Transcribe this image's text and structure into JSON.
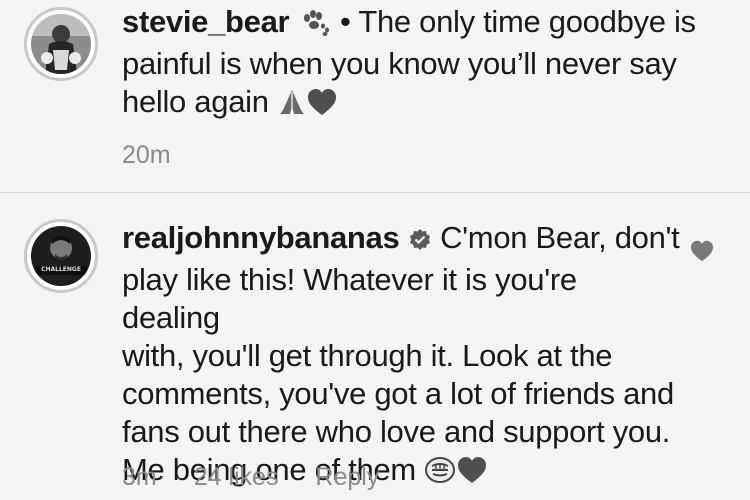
{
  "comments": [
    {
      "username": "stevie_bear",
      "separator": "•",
      "text_line1": "The only time goodbye is",
      "text_line2": "painful is when you know you’ll never say",
      "text_line3": "hello again",
      "time": "20m"
    },
    {
      "username": "realjohnnybananas",
      "text_line1": "C'mon Bear, don't",
      "text_line2": "play like this! Whatever it is you're dealing",
      "text_line3": "with, you'll get through it. Look at the",
      "text_line4": "comments, you've got a lot of friends and",
      "text_line5": "fans out there who love and support you.",
      "text_line6": "Me being one of them",
      "time": "3m",
      "likes": "24 likes",
      "reply_label": "Reply",
      "avatar_badge": "CHALLENGE"
    }
  ],
  "icons": {
    "paw": "paw-prints-icon",
    "prayer": "folded-hands-icon",
    "heart": "heart-icon",
    "verified": "verified-badge-icon",
    "fist": "raised-fist-icon",
    "like": "like-heart-icon"
  }
}
